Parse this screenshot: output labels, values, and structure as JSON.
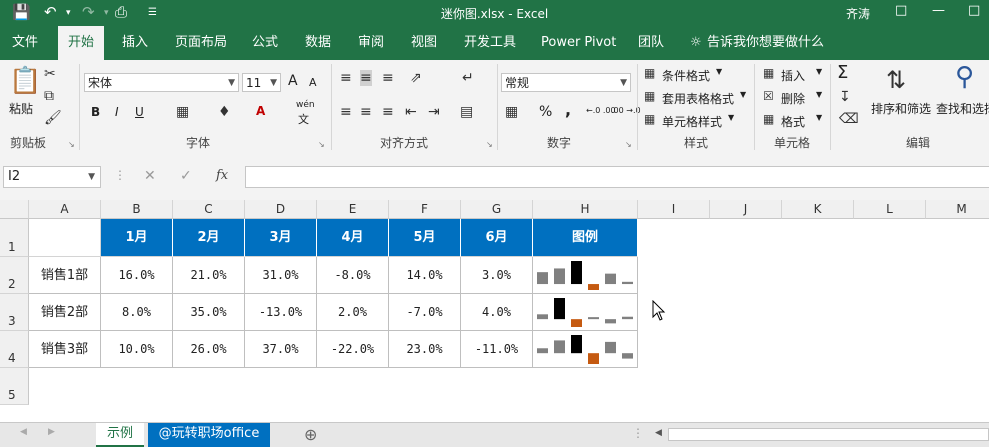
{
  "titlebar": {
    "title": "迷你图.xlsx  -  Excel",
    "user": "齐涛",
    "qa_save_icon": "save-icon",
    "qa_undo_icon": "undo-icon",
    "qa_redo_icon": "redo-icon",
    "qa_preview_icon": "print-preview-icon"
  },
  "tabs": [
    "文件",
    "开始",
    "插入",
    "页面布局",
    "公式",
    "数据",
    "审阅",
    "视图",
    "开发工具",
    "Power Pivot",
    "团队"
  ],
  "tell_me": "告诉我你想要做什么",
  "ribbon": {
    "paste": "粘贴",
    "clipboard": "剪贴板",
    "font_name": "宋体",
    "font_size": "11",
    "font_group": "字体",
    "align_group": "对齐方式",
    "number_format": "常规",
    "number_group": "数字",
    "cond_format": "条件格式",
    "table_format": "套用表格格式",
    "cell_style": "单元格样式",
    "style_group": "样式",
    "insert": "插入",
    "delete": "删除",
    "format": "格式",
    "cells_group": "单元格",
    "sort_filter": "排序和筛选",
    "find_select": "查找和选择",
    "edit_group": "编辑",
    "bold": "B",
    "italic": "I",
    "underline": "U",
    "wen": "wén",
    "wen_char": "文",
    "percent": "%",
    "comma": ",",
    "inc_dec": "←.0 .00",
    "dec_dec": ".00 →.0",
    "font_grow": "A",
    "font_shrink": "A",
    "font_color": "A",
    "sigma": "Σ"
  },
  "formula_bar": {
    "namebox": "I2",
    "fx": "fx",
    "value": ""
  },
  "columns": [
    "A",
    "B",
    "C",
    "D",
    "E",
    "F",
    "G",
    "H",
    "I",
    "J",
    "K",
    "L",
    "M"
  ],
  "rows": [
    "1",
    "2",
    "3",
    "4",
    "5"
  ],
  "table": {
    "headers": [
      "1月",
      "2月",
      "3月",
      "4月",
      "5月",
      "6月",
      "图例"
    ],
    "data": [
      {
        "label": "销售1部",
        "values": [
          "16.0%",
          "21.0%",
          "31.0%",
          "-8.0%",
          "14.0%",
          "3.0%"
        ]
      },
      {
        "label": "销售2部",
        "values": [
          "8.0%",
          "35.0%",
          "-13.0%",
          "2.0%",
          "-7.0%",
          "4.0%"
        ]
      },
      {
        "label": "销售3部",
        "values": [
          "10.0%",
          "26.0%",
          "37.0%",
          "-22.0%",
          "23.0%",
          "-11.0%"
        ]
      }
    ]
  },
  "sparklines": [
    [
      16,
      21,
      31,
      -8,
      14,
      3
    ],
    [
      8,
      35,
      -13,
      2,
      -7,
      4
    ],
    [
      10,
      26,
      37,
      -22,
      23,
      -11
    ]
  ],
  "sparkline_colors": {
    "normal": "#808080",
    "high": "#000000",
    "low": "#c55a11"
  },
  "sheet_tabs": [
    "示例",
    "@玩转职场office"
  ]
}
